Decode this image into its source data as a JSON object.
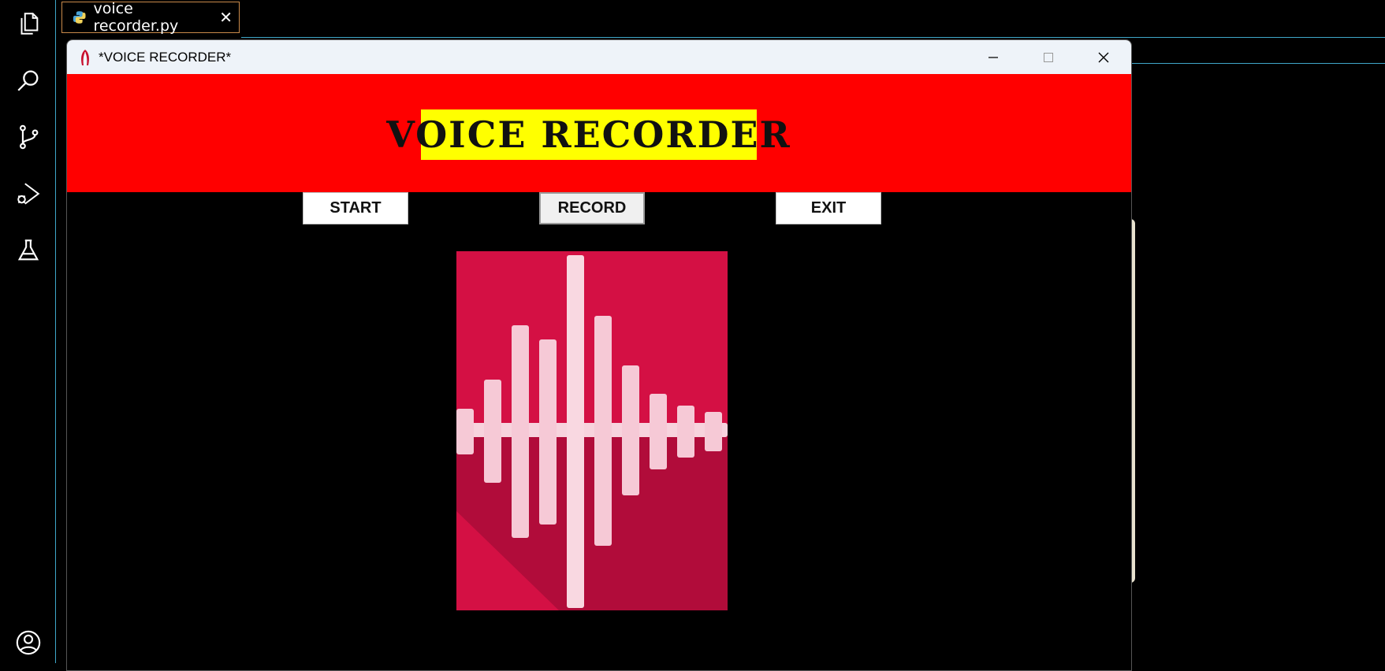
{
  "editor": {
    "tab": {
      "label": "voice recorder.py"
    },
    "activity_bar": [
      "explorer-icon",
      "search-icon",
      "source-control-icon",
      "run-debug-icon",
      "testing-icon",
      "account-icon"
    ]
  },
  "window": {
    "title": "*VOICE RECORDER*",
    "controls": [
      "minimize",
      "maximize",
      "close"
    ]
  },
  "app": {
    "header_bg": "#ff0000",
    "banner": {
      "text": "VOICE RECORDER",
      "bg": "#ffff00"
    },
    "buttons": {
      "start": "START",
      "record": "RECORD",
      "exit": "EXIT"
    },
    "image": {
      "name": "soundwave-image",
      "bg": "#d41044",
      "bar_color": "#f6c9d6"
    }
  }
}
